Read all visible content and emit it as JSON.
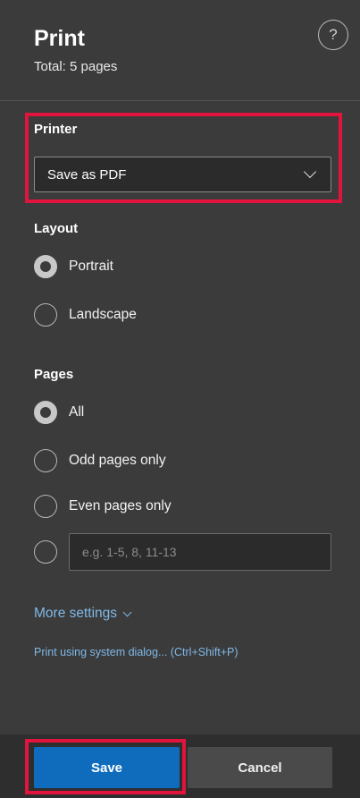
{
  "header": {
    "title": "Print",
    "subtitle": "Total: 5 pages",
    "help_glyph": "?"
  },
  "printer": {
    "label": "Printer",
    "selected": "Save as PDF"
  },
  "layout": {
    "label": "Layout",
    "options": [
      {
        "label": "Portrait",
        "checked": true
      },
      {
        "label": "Landscape",
        "checked": false
      }
    ]
  },
  "pages": {
    "label": "Pages",
    "options": [
      {
        "label": "All",
        "checked": true
      },
      {
        "label": "Odd pages only",
        "checked": false
      },
      {
        "label": "Even pages only",
        "checked": false
      }
    ],
    "custom_placeholder": "e.g. 1-5, 8, 11-13"
  },
  "links": {
    "more_settings": "More settings",
    "system_dialog": "Print using system dialog... (Ctrl+Shift+P)"
  },
  "footer": {
    "save_label": "Save",
    "cancel_label": "Cancel"
  },
  "colors": {
    "highlight": "#e0143c",
    "primary_button": "#0f6cbd",
    "link": "#7fb8e8",
    "panel_bg": "#3b3b3b"
  }
}
